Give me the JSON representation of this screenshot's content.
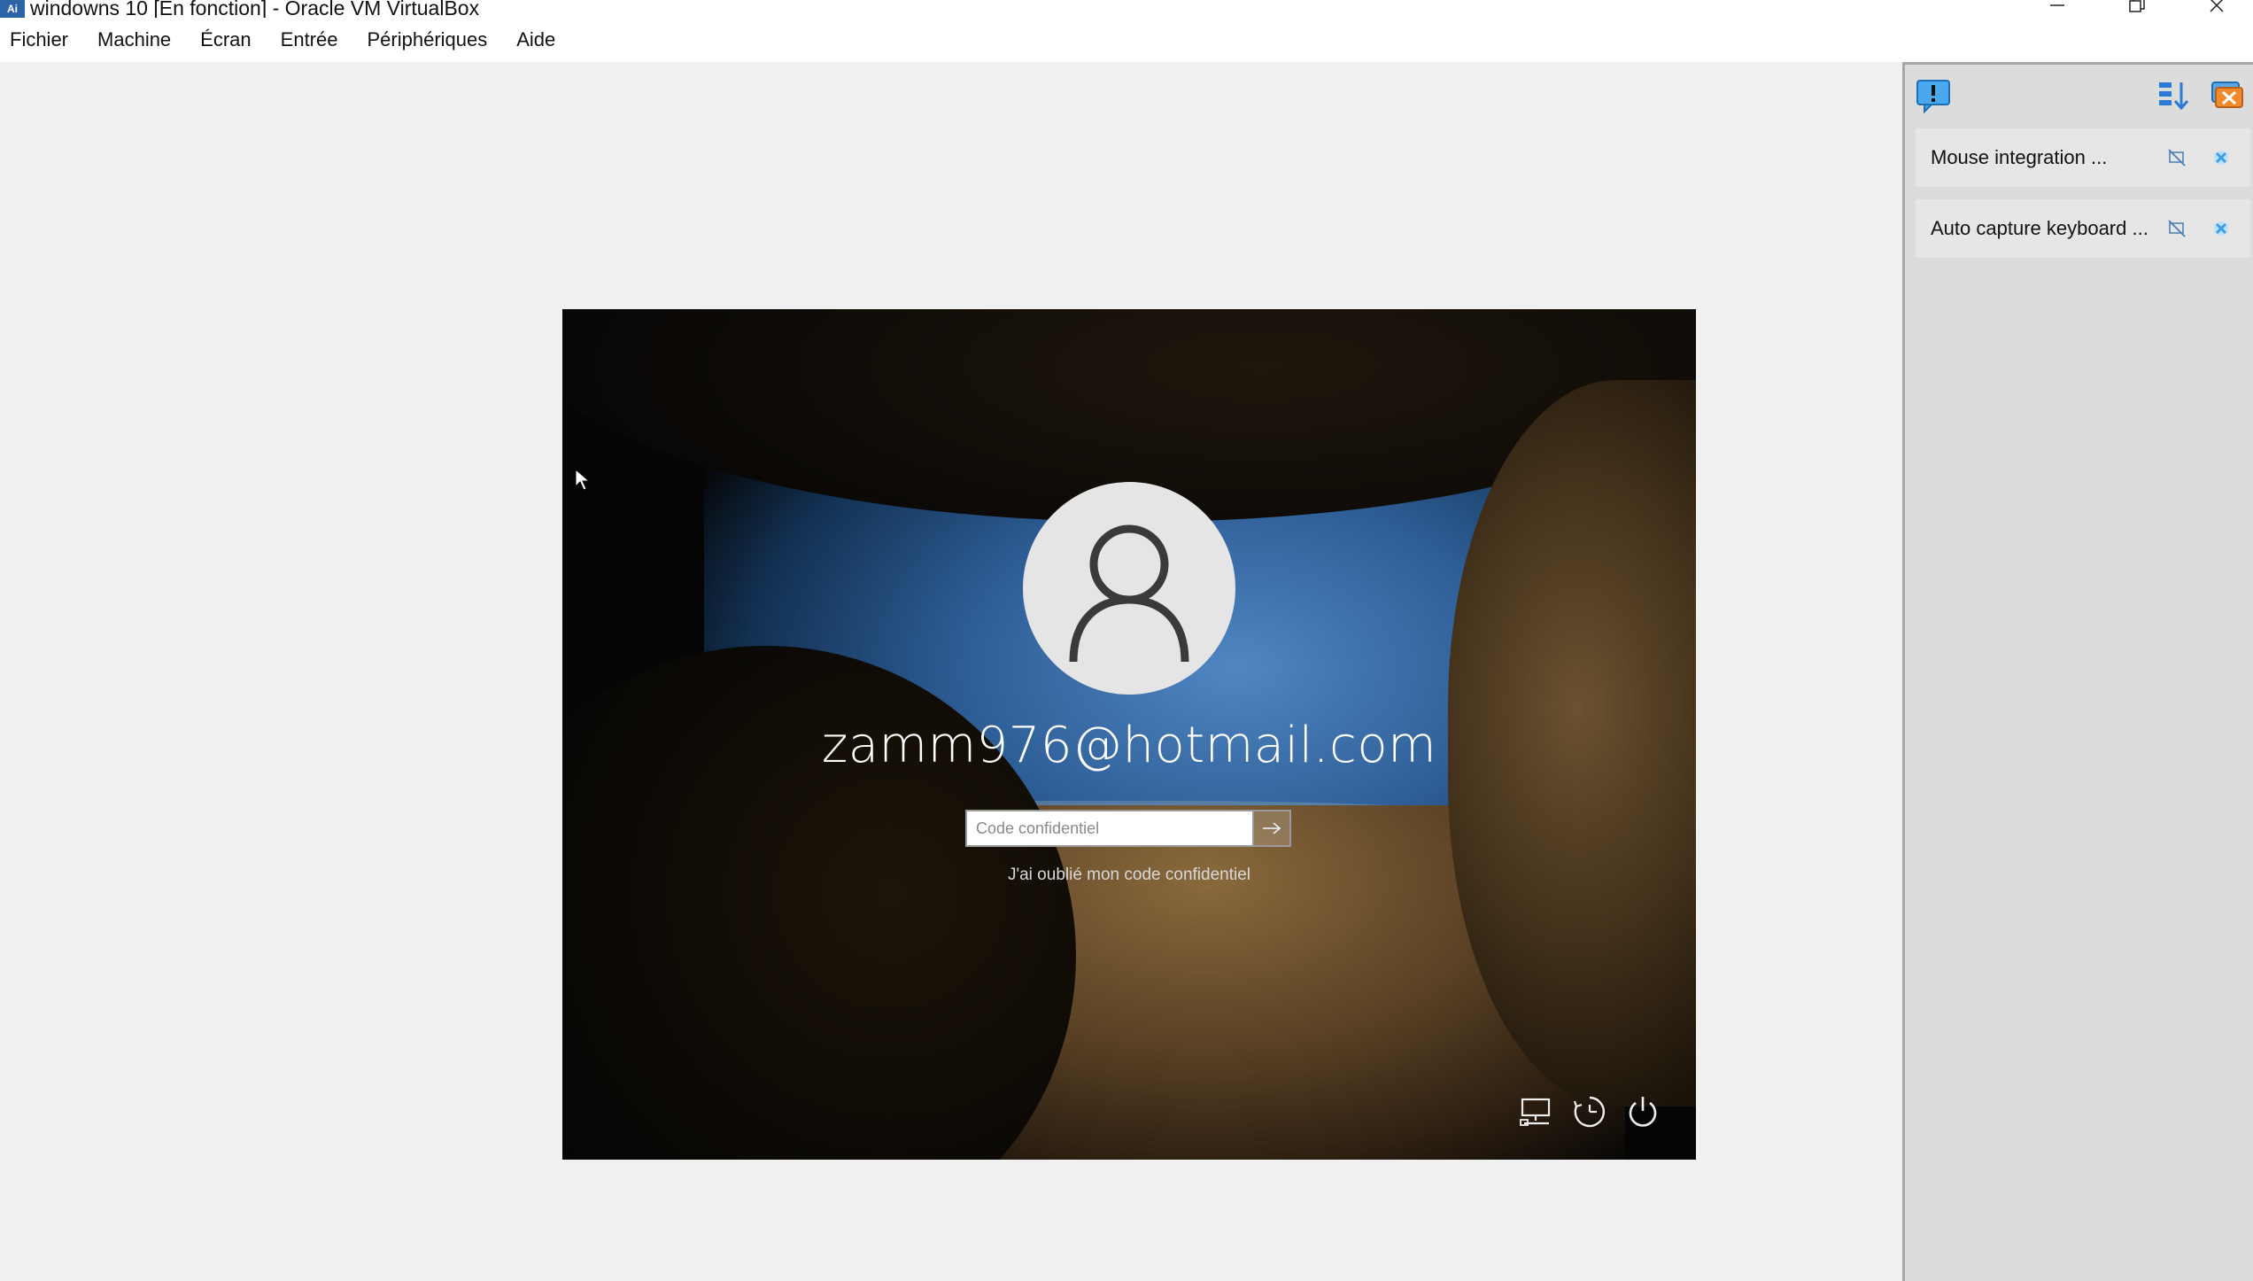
{
  "window": {
    "title": "windowns 10 [En fonction] - Oracle VM VirtualBox",
    "app_icon_text": "Ai"
  },
  "menubar": {
    "items": [
      {
        "label": "Fichier"
      },
      {
        "label": "Machine"
      },
      {
        "label": "Écran"
      },
      {
        "label": "Entrée"
      },
      {
        "label": "Périphériques"
      },
      {
        "label": "Aide"
      }
    ]
  },
  "vm_screen": {
    "username": "zamm976@hotmail.com",
    "pin_placeholder": "Code confidentiel",
    "pin_value": "",
    "forgot_link": "J'ai oublié mon code confidentiel",
    "tray_icons": [
      "network-icon",
      "ease-of-access-icon",
      "power-icon"
    ]
  },
  "notifications": {
    "items": [
      {
        "label": "Mouse integration ..."
      },
      {
        "label": "Auto capture keyboard ..."
      }
    ]
  },
  "colors": {
    "panel_accent": "#2a7ad6",
    "close_x": "#3ba0e6"
  }
}
